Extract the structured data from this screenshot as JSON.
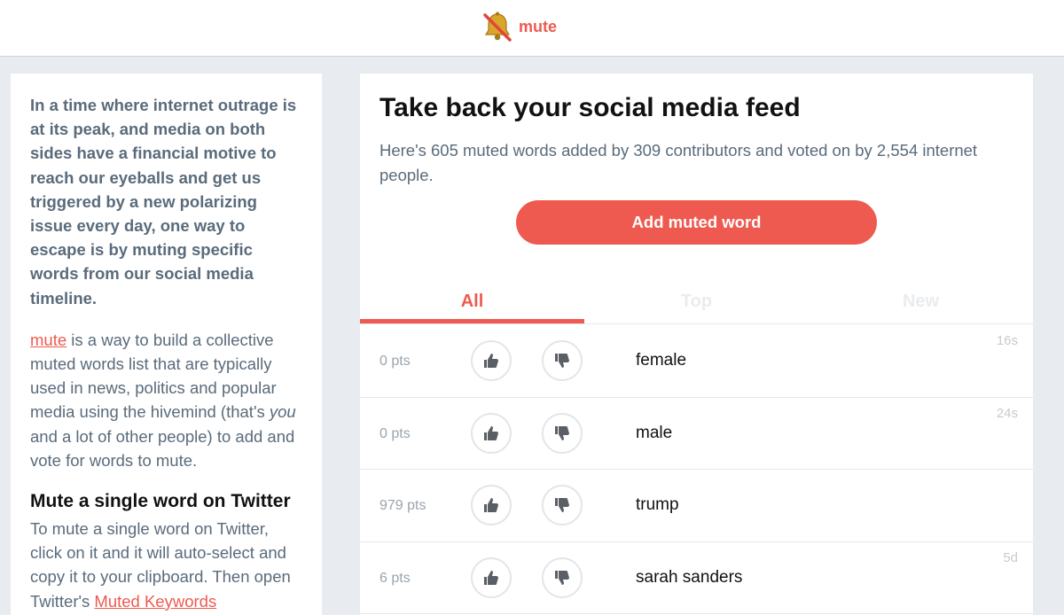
{
  "brand": {
    "name": "mute",
    "accent": "#ee5a4f",
    "icon": "muted-bell-icon"
  },
  "left": {
    "intro": "In a time where internet outrage is at its peak, and media on both sides have a financial motive to reach our eyeballs and get us triggered by a new polarizing issue every day, one way to escape is by muting specific words from our social media timeline.",
    "link_mute": "mute",
    "p2_a": " is a way to build a collective muted words list that are typically used in news, politics and popular media using the hivemind (that's ",
    "p2_em": "you",
    "p2_b": " and a lot of other people) to add and vote for words to mute.",
    "heading": "Mute a single word on Twitter",
    "p3": "To mute a single word on Twitter, click on it and it will auto-select and copy it to your clipboard. Then open Twitter's ",
    "link_muted_keywords": "Muted Keywords"
  },
  "main": {
    "title": "Take back your social media feed",
    "subtitle": "Here's 605 muted words added by 309 contributors and voted on by 2,554 internet people.",
    "add_button": "Add muted word",
    "tabs": [
      "All",
      "Top",
      "New"
    ],
    "rows": [
      {
        "pts": "0 pts",
        "word": "female",
        "age": "16s"
      },
      {
        "pts": "0 pts",
        "word": "male",
        "age": "24s"
      },
      {
        "pts": "979 pts",
        "word": "trump",
        "age": ""
      },
      {
        "pts": "6 pts",
        "word": "sarah sanders",
        "age": "5d"
      }
    ]
  }
}
